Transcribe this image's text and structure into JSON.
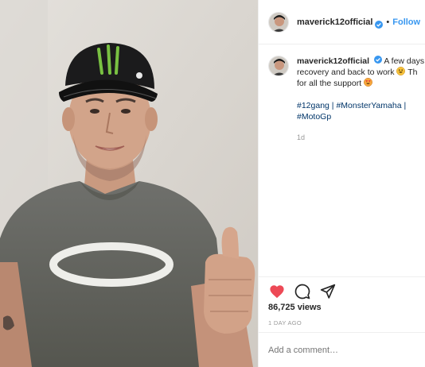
{
  "header": {
    "username": "maverick12official",
    "separator": "•",
    "follow_label": "Follow"
  },
  "caption": {
    "username": "maverick12official",
    "line1": "A few days o",
    "line2": "recovery and back to work",
    "line2_tail": "Th",
    "line3": "for all the support",
    "tags_line1": "#12gang | #MonsterYamaha |",
    "tags_line2": "#MotoGp",
    "age": "1d"
  },
  "actions": {
    "views": "86,725 views",
    "timestamp": "1 DAY AGO"
  },
  "comment": {
    "placeholder": "Add a comment…"
  },
  "icons": {
    "like": "heart-icon",
    "comment": "comment-icon",
    "share": "share-icon",
    "verified": "verified-badge-icon"
  },
  "colors": {
    "link_blue": "#3897f0",
    "hashtag": "#003569",
    "like_red": "#ed4956",
    "muted": "#999999",
    "text": "#262626"
  }
}
